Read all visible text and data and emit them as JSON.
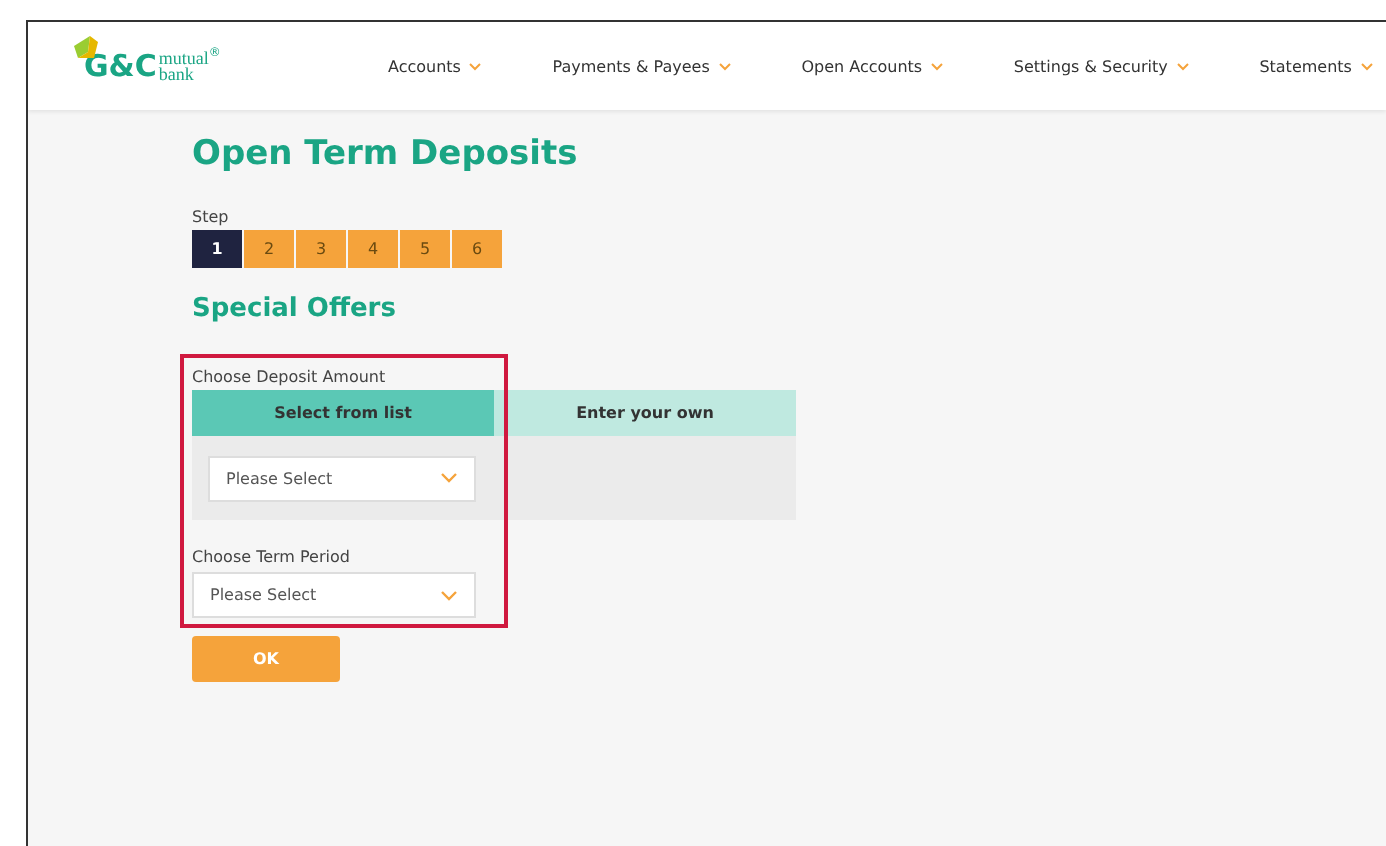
{
  "logo": {
    "initials": "G&C",
    "word_top": "mutual",
    "word_bottom": "bank",
    "mark": "®"
  },
  "nav": [
    {
      "label": "Accounts"
    },
    {
      "label": "Payments & Payees"
    },
    {
      "label": "Open Accounts"
    },
    {
      "label": "Settings & Security"
    },
    {
      "label": "Statements"
    }
  ],
  "title": "Open Term Deposits",
  "stepper": {
    "label": "Step",
    "steps": [
      {
        "label": "1",
        "selected": true
      },
      {
        "label": "2",
        "selected": false
      },
      {
        "label": "3",
        "selected": false
      },
      {
        "label": "4",
        "selected": false
      },
      {
        "label": "5",
        "selected": false
      },
      {
        "label": "6",
        "selected": false
      }
    ]
  },
  "section_title": "Special Offers",
  "deposit": {
    "label": "Choose Deposit Amount",
    "tabs": [
      {
        "label": "Select from list",
        "selected": true
      },
      {
        "label": "Enter your own",
        "selected": false
      }
    ],
    "select": {
      "placeholder": "Please Select"
    }
  },
  "term": {
    "label": "Choose Term Period",
    "select": {
      "placeholder": "Please Select"
    }
  },
  "ok_button": "OK"
}
